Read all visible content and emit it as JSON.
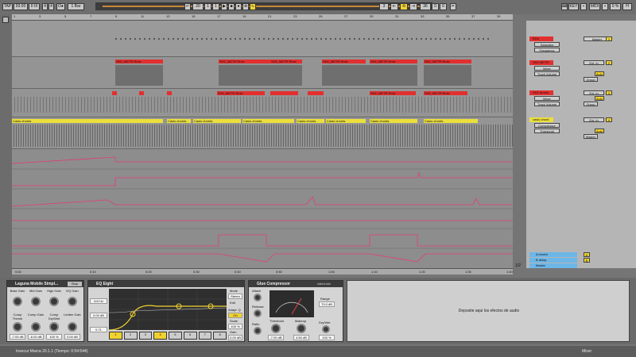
{
  "control_bar": {
    "tap": "TAP",
    "tempo": "93.00",
    "tempo_nudge": "II  III",
    "signature_num": "4",
    "signature_den": "4",
    "metronome": "O●",
    "quantize": "1 Bar",
    "position_bar": "20",
    "position_beat": "1",
    "position_sixteenth": "1",
    "loop_start": "3",
    "loop_length_bar": "36",
    "loop_length_beat": "0",
    "loop_length_sixteenth": "0",
    "key": "KEY",
    "midi": "MIDI",
    "cpu": "0 %",
    "draw_mode": "✏"
  },
  "timeline": {
    "bars": [
      "1",
      "3",
      "5",
      "7",
      "9",
      "11",
      "13",
      "15",
      "17",
      "19",
      "21",
      "23",
      "25",
      "27",
      "29",
      "31",
      "33",
      "35",
      "37",
      "39"
    ],
    "times": [
      "0:00",
      "0:10",
      "0:20",
      "0:30",
      "0:40",
      "0:50",
      "1:00",
      "1:10",
      "1:20",
      "1:30",
      "1:40",
      "1:50"
    ],
    "page": "1/2"
  },
  "clips": {
    "red_label": "SH2_METR Rmix",
    "yellow_label": "Casio chords"
  },
  "automation_labels": [
    {
      "line1": "Mixer",
      "line2": "B-delay"
    },
    {
      "line1": "Auto Filter",
      "line2": "Device On"
    },
    {
      "line1": "Auto Filter",
      "line2": "Frequency"
    },
    {
      "line1": "Auto Filter",
      "line2": "Resonance"
    },
    {
      "line1": "Decimort 2",
      "line2": "Device On"
    },
    {
      "line1": "Decimort 2",
      "line2": "Resample Frequer"
    }
  ],
  "tracks": [
    {
      "name": "Eins",
      "color": "#e22f2f",
      "input": "Master",
      "device": "Saturator",
      "param": "Frequency",
      "num": "1"
    },
    {
      "name": "SH2 METR",
      "color": "#e22f2f",
      "input": "Ext. In",
      "device": "Mixer",
      "param": "Track Volume",
      "num": "2"
    },
    {
      "name": "SH2 drums",
      "color": "#e22f2f",
      "input": "Ext. In",
      "device": "Mixer",
      "param": "Track Volume",
      "num": "3"
    },
    {
      "name": "casio chord",
      "color": "#ecdf3c",
      "input": "Ext. In",
      "device": "Compressor",
      "param": "Threshold",
      "num": "4"
    }
  ],
  "returns": [
    {
      "name": "A reverb",
      "num": "A"
    },
    {
      "name": "B delay",
      "num": "B"
    },
    {
      "name": "Master",
      "num": "M"
    }
  ],
  "mixer_buttons": {
    "auto": "Auto",
    "in": "In",
    "off": "Off",
    "group": "Group",
    "mixer": "Mixer",
    "none": "None",
    "master": "Master"
  },
  "devices": {
    "laguna": {
      "title": "Laguna Mobile Simpl...",
      "stop": "Stop",
      "knobs": [
        {
          "label": "Base Gain",
          "value": "?"
        },
        {
          "label": "Mid Gain",
          "value": "?"
        },
        {
          "label": "High Gain",
          "value": "?"
        },
        {
          "label": "EQ Gain",
          "value": "?"
        },
        {
          "label": "Comp Thresh",
          "value": "-7.00 dB"
        },
        {
          "label": "Comp Gain",
          "value": "-6.00 dB"
        },
        {
          "label": "Comp Dry/Wet",
          "value": "100 %"
        },
        {
          "label": "Limiter Gain",
          "value": "0.00 dB"
        }
      ]
    },
    "eq": {
      "title": "EQ Eight",
      "freq": "110 Hz",
      "gain": "0.00 dB",
      "q": "0.71",
      "mode": "Mode",
      "mode_val": "Stereo",
      "edit": "Edit",
      "adapt_q": "Adapt. Q",
      "adapt_q_val": "On",
      "scale": "Scale",
      "scale_val": "100 %",
      "gain_lbl": "Gain",
      "gain_val": "0.00 dB",
      "bands": [
        "1",
        "2",
        "3",
        "4",
        "5",
        "6",
        "7",
        "8"
      ]
    },
    "glue": {
      "title": "Glue Compressor",
      "preset": "sidechain",
      "attack": "Attack",
      "attack_val": "0.3",
      "release": "Release",
      "release_val": "0.1",
      "ratio": "Ratio",
      "ratio_val": "4",
      "threshold": "Threshold",
      "threshold_val": "-7.00 dB",
      "makeup": "Makeup",
      "makeup_val": "4.50 dB",
      "range": "Range",
      "range_val": "70.0 dB",
      "drywet": "Dry/Wet",
      "drywet_val": "100 %"
    },
    "drop_hint": "Deposite aqui los efectos de audio"
  },
  "status_bar": {
    "text": "Insecur Marca 20.1.1 (Tiempo: 0:54:544)",
    "right": "Mixer"
  }
}
